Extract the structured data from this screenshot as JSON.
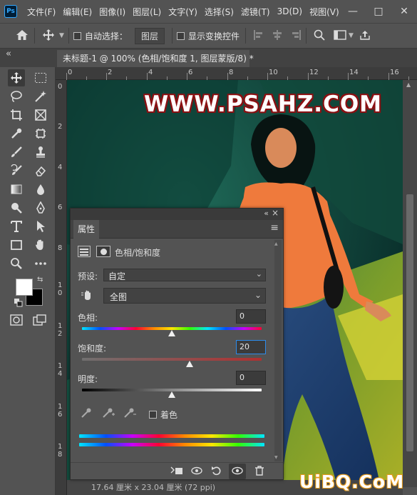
{
  "menubar": {
    "logo": "Ps",
    "items": [
      "文件(F)",
      "编辑(E)",
      "图像(I)",
      "图层(L)",
      "文字(Y)",
      "选择(S)",
      "滤镜(T)",
      "3D(D)",
      "视图(V)"
    ],
    "window_controls": [
      "—",
      "□",
      "✕"
    ]
  },
  "options_bar": {
    "auto_select_label": "自动选择：",
    "auto_select_target": "图层",
    "show_transform_label": "显示变换控件"
  },
  "collapse_left": "«",
  "document_tab": {
    "title": "未标题-1 @ 100% (色相/饱和度 1, 图层蒙版/8) *",
    "close": "×"
  },
  "ruler": {
    "h_ticks": [
      "0",
      "2",
      "4",
      "6",
      "8",
      "10",
      "12",
      "14",
      "16"
    ],
    "v_ticks": [
      "0",
      "2",
      "4",
      "6",
      "8",
      "1 0",
      "1 2",
      "1 4",
      "1 6",
      "1 8"
    ]
  },
  "watermark_top": "WWW.PSAHZ.COM",
  "watermark_bottom": "UiBQ.CoM",
  "status_bar": "17.64 厘米 x 23.04 厘米 (72 ppi)",
  "panel": {
    "collapse": "«",
    "close": "×",
    "tab": "属性",
    "menu_icon": "≡",
    "adjustment_title": "色相/饱和度",
    "preset_label": "预设:",
    "preset_value": "自定",
    "range_value": "全图",
    "hue_label": "色相:",
    "hue_value": "0",
    "saturation_label": "饱和度:",
    "saturation_value": "20",
    "lightness_label": "明度:",
    "lightness_value": "0",
    "colorize_label": "着色"
  },
  "slider_levels": {
    "hue": {
      "min": -180,
      "max": 180,
      "value": 0
    },
    "saturation": {
      "min": -100,
      "max": 100,
      "value": 20
    },
    "lightness": {
      "min": -100,
      "max": 100,
      "value": 0
    }
  },
  "colors": {
    "accent_focus": "#2d8ceb",
    "watermark_outline": "#8a1012",
    "watermark2_outline": "#e69a1a"
  }
}
